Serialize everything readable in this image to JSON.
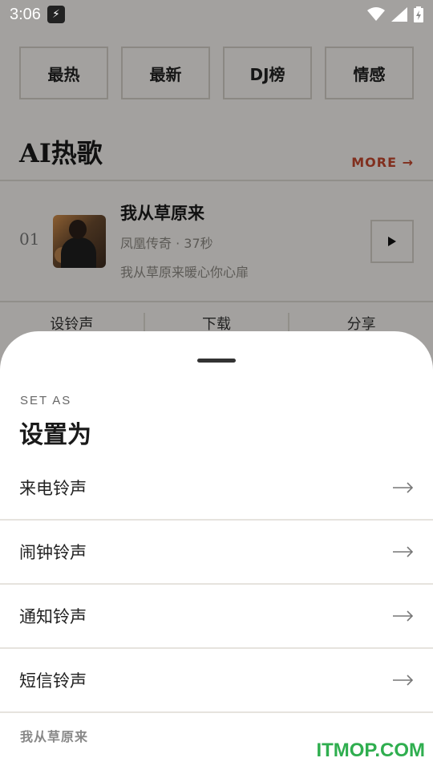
{
  "status_bar": {
    "time": "3:06"
  },
  "tabs": [
    {
      "label": "最热"
    },
    {
      "label": "最新"
    },
    {
      "label": "DJ榜"
    },
    {
      "label": "情感"
    }
  ],
  "section": {
    "title": "AI热歌",
    "more_label": "MORE →"
  },
  "song": {
    "rank": "01",
    "name": "我从草原来",
    "meta": "凤凰传奇 · 37秒",
    "description": "我从草原来暖心你心扉"
  },
  "actions": [
    {
      "label": "设铃声"
    },
    {
      "label": "下载"
    },
    {
      "label": "分享"
    }
  ],
  "sheet": {
    "eyebrow": "SET AS",
    "title": "设置为",
    "options": [
      {
        "label": "来电铃声"
      },
      {
        "label": "闹钟铃声"
      },
      {
        "label": "通知铃声"
      },
      {
        "label": "短信铃声"
      }
    ],
    "footer": "我从草原来"
  },
  "watermark": "ITMOP.COM",
  "colors": {
    "accent": "#c0462d",
    "background": "#f3f1ed",
    "watermark": "#2fae4f"
  }
}
